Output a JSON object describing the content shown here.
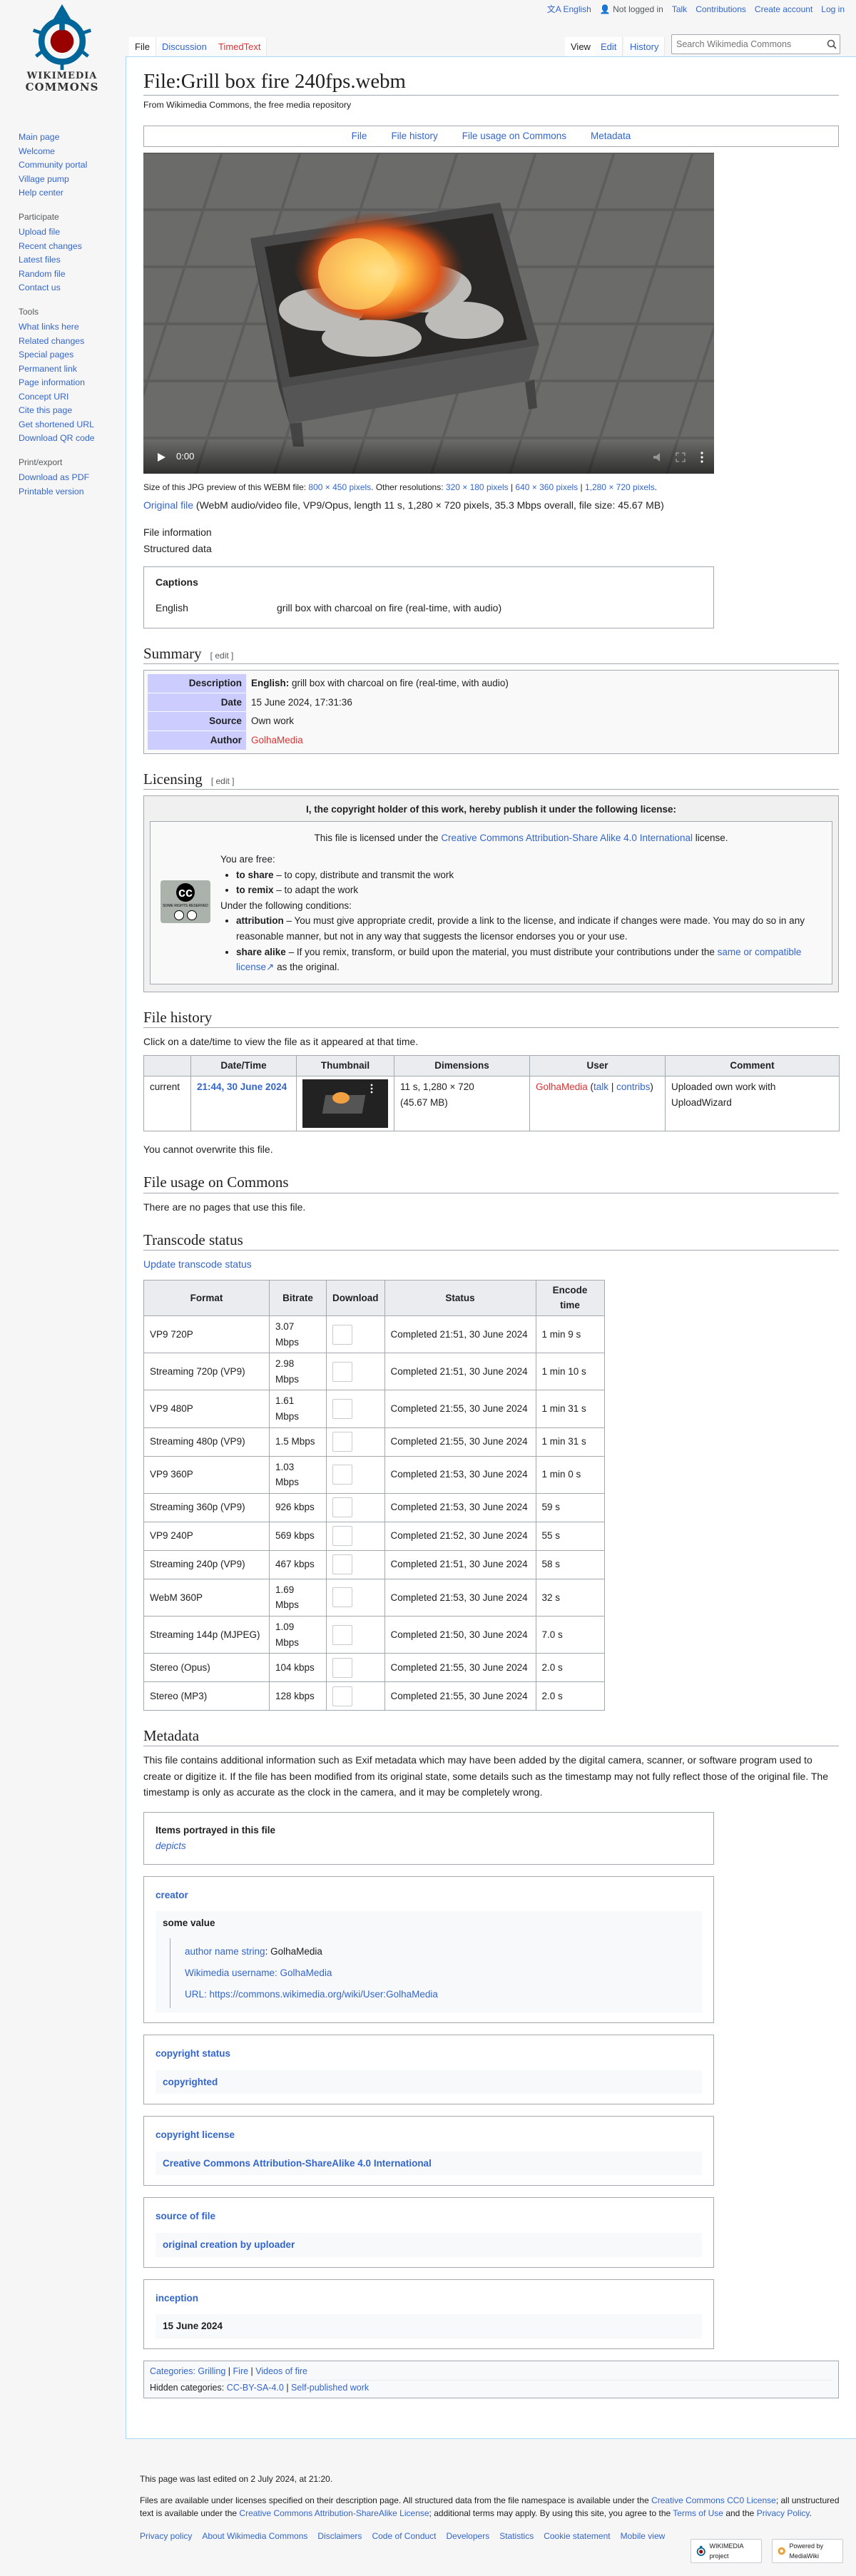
{
  "logo": {
    "line1": "WIKIMEDIA",
    "line2": "COMMONS"
  },
  "personal": {
    "language": "English",
    "not_logged_in": "Not logged in",
    "talk": "Talk",
    "contributions": "Contributions",
    "create": "Create account",
    "login": "Log in"
  },
  "tabs": {
    "file": "File",
    "discussion": "Discussion",
    "timedtext": "TimedText",
    "view": "View",
    "edit": "Edit",
    "history": "History"
  },
  "search": {
    "placeholder": "Search Wikimedia Commons"
  },
  "sidebar": {
    "nav": [
      "Main page",
      "Welcome",
      "Community portal",
      "Village pump",
      "Help center"
    ],
    "participate_hd": "Participate",
    "participate": [
      "Upload file",
      "Recent changes",
      "Latest files",
      "Random file",
      "Contact us"
    ],
    "tools_hd": "Tools",
    "tools": [
      "What links here",
      "Related changes",
      "Special pages",
      "Permanent link",
      "Page information",
      "Concept URI",
      "Cite this page",
      "Get shortened URL",
      "Download QR code"
    ],
    "print_hd": "Print/export",
    "print": [
      "Download as PDF",
      "Printable version"
    ]
  },
  "title": "File:Grill box fire 240fps.webm",
  "site_sub": "From Wikimedia Commons, the free media repository",
  "filetoc": [
    "File",
    "File history",
    "File usage on Commons",
    "Metadata"
  ],
  "video": {
    "time": "0:00"
  },
  "preview": {
    "text": "Size of this JPG preview of this WEBM file:",
    "size": "800 × 450 pixels",
    "other": ". Other resolutions:",
    "r1": "320 × 180 pixels",
    "r2": "640 × 360 pixels",
    "r3": "1,280 × 720 pixels",
    "end": "."
  },
  "original": {
    "link": "Original file",
    "info": " (WebM audio/video file, VP9/Opus, length 11 s, 1,280 × 720 pixels, 35.3 Mbps overall, file size: 45.67 MB)"
  },
  "tabs2": {
    "fileinfo": "File information",
    "structured": "Structured data"
  },
  "captions": {
    "title": "Captions",
    "lang": "English",
    "text": "grill box with charcoal on fire (real-time, with audio)"
  },
  "summary": {
    "heading": "Summary",
    "edit": "[ edit ]",
    "desc_l": "Description",
    "desc_lang": "English:",
    "desc_v": " grill box with charcoal on fire (real-time, with audio)",
    "date_l": "Date",
    "date_v": "15 June 2024, 17:31:36",
    "src_l": "Source",
    "src_v": "Own work",
    "auth_l": "Author",
    "auth_v": "GolhaMedia"
  },
  "licensing": {
    "heading": "Licensing",
    "edit": "[ edit ]",
    "header": "I, the copyright holder of this work, hereby publish it under the following license:",
    "lic_pre": "This file is licensed under the ",
    "lic_link": "Creative Commons Attribution-Share Alike 4.0 International",
    "lic_post": " license.",
    "free": "You are free:",
    "share_b": "to share",
    "share_t": " – to copy, distribute and transmit the work",
    "remix_b": "to remix",
    "remix_t": " – to adapt the work",
    "cond": "Under the following conditions:",
    "attr_b": "attribution",
    "attr_t": " – You must give appropriate credit, provide a link to the license, and indicate if changes were made. You may do so in any reasonable manner, but not in any way that suggests the licensor endorses you or your use.",
    "sa_b": "share alike",
    "sa_t": " – If you remix, transform, or build upon the material, you must distribute your contributions under the ",
    "sa_link": "same or compatible license",
    "sa_end": " as the original.",
    "cc_text": "SOME RIGHTS RESERVED"
  },
  "history": {
    "heading": "File history",
    "hint": "Click on a date/time to view the file as it appeared at that time.",
    "cols": [
      "",
      "Date/Time",
      "Thumbnail",
      "Dimensions",
      "User",
      "Comment"
    ],
    "current": "current",
    "datetime": "21:44, 30 June 2024",
    "dims": "11 s, 1,280 × 720",
    "size": "(45.67 MB)",
    "user": "GolhaMedia",
    "talk": "talk",
    "contribs": "contribs",
    "comment": "Uploaded own work with UploadWizard",
    "no_overwrite": "You cannot overwrite this file."
  },
  "usage": {
    "heading": "File usage on Commons",
    "text": "There are no pages that use this file."
  },
  "transcode": {
    "heading": "Transcode status",
    "update": "Update transcode status",
    "cols": [
      "Format",
      "Bitrate",
      "Download",
      "Status",
      "Encode time"
    ],
    "rows": [
      [
        "VP9 720P",
        "3.07 Mbps",
        "Completed 21:51, 30 June 2024",
        "1 min 9 s"
      ],
      [
        "Streaming 720p (VP9)",
        "2.98 Mbps",
        "Completed 21:51, 30 June 2024",
        "1 min 10 s"
      ],
      [
        "VP9 480P",
        "1.61 Mbps",
        "Completed 21:55, 30 June 2024",
        "1 min 31 s"
      ],
      [
        "Streaming 480p (VP9)",
        "1.5 Mbps",
        "Completed 21:55, 30 June 2024",
        "1 min 31 s"
      ],
      [
        "VP9 360P",
        "1.03 Mbps",
        "Completed 21:53, 30 June 2024",
        "1 min 0 s"
      ],
      [
        "Streaming 360p (VP9)",
        "926 kbps",
        "Completed 21:53, 30 June 2024",
        "59 s"
      ],
      [
        "VP9 240P",
        "569 kbps",
        "Completed 21:52, 30 June 2024",
        "55 s"
      ],
      [
        "Streaming 240p (VP9)",
        "467 kbps",
        "Completed 21:51, 30 June 2024",
        "58 s"
      ],
      [
        "WebM 360P",
        "1.69 Mbps",
        "Completed 21:53, 30 June 2024",
        "32 s"
      ],
      [
        "Streaming 144p (MJPEG)",
        "1.09 Mbps",
        "Completed 21:50, 30 June 2024",
        "7.0 s"
      ],
      [
        "Stereo (Opus)",
        "104 kbps",
        "Completed 21:55, 30 June 2024",
        "2.0 s"
      ],
      [
        "Stereo (MP3)",
        "128 kbps",
        "Completed 21:55, 30 June 2024",
        "2.0 s"
      ]
    ]
  },
  "metadata": {
    "heading": "Metadata",
    "text": "This file contains additional information such as Exif metadata which may have been added by the digital camera, scanner, or software program used to create or digitize it. If the file has been modified from its original state, some details such as the timestamp may not fully reflect those of the original file. The timestamp is only as accurate as the clock in the camera, and it may be completely wrong."
  },
  "sd": {
    "items_title": "Items portrayed in this file",
    "depicts": "depicts",
    "creator": "creator",
    "some_value": "some value",
    "q1_l": "author name string",
    "q1_v": ": GolhaMedia",
    "q2_l": "Wikimedia username",
    "q2_v": ": GolhaMedia",
    "q3_l": "URL",
    "q3_v": ": https://commons.wikimedia.org/wiki/User:GolhaMedia",
    "cs": "copyright status",
    "cs_v": "copyrighted",
    "cl": "copyright license",
    "cl_v": "Creative Commons Attribution-ShareAlike 4.0 International",
    "sof": "source of file",
    "sof_v": "original creation by uploader",
    "inc": "inception",
    "inc_v": "15 June 2024"
  },
  "cats": {
    "label": "Categories:",
    "c1": "Grilling",
    "c2": "Fire",
    "c3": "Videos of fire",
    "hidden": "Hidden categories:",
    "h1": "CC-BY-SA-4.0",
    "h2": "Self-published work"
  },
  "footer": {
    "edited": "This page was last edited on 2 July 2024, at 21:20.",
    "lic1": "Files are available under licenses specified on their description page. All structured data from the file namespace is available under the ",
    "cc0": "Creative Commons CC0 License",
    "lic2": "; all unstructured text is available under the ",
    "ccbysa": "Creative Commons Attribution-ShareAlike License",
    "lic3": "; additional terms may apply. By using this site, you agree to the ",
    "tou": "Terms of Use",
    "and": " and the ",
    "pp": "Privacy Policy",
    "dot": ".",
    "links": [
      "Privacy policy",
      "About Wikimedia Commons",
      "Disclaimers",
      "Code of Conduct",
      "Developers",
      "Statistics",
      "Cookie statement",
      "Mobile view"
    ],
    "wm_badge": "WIKIMEDIA project",
    "mw_badge": "Powered by MediaWiki"
  },
  "colors": {
    "link": "#3366cc",
    "redlink": "#d33333",
    "summary_th": "#ccccff",
    "border": "#a2a9b1"
  }
}
